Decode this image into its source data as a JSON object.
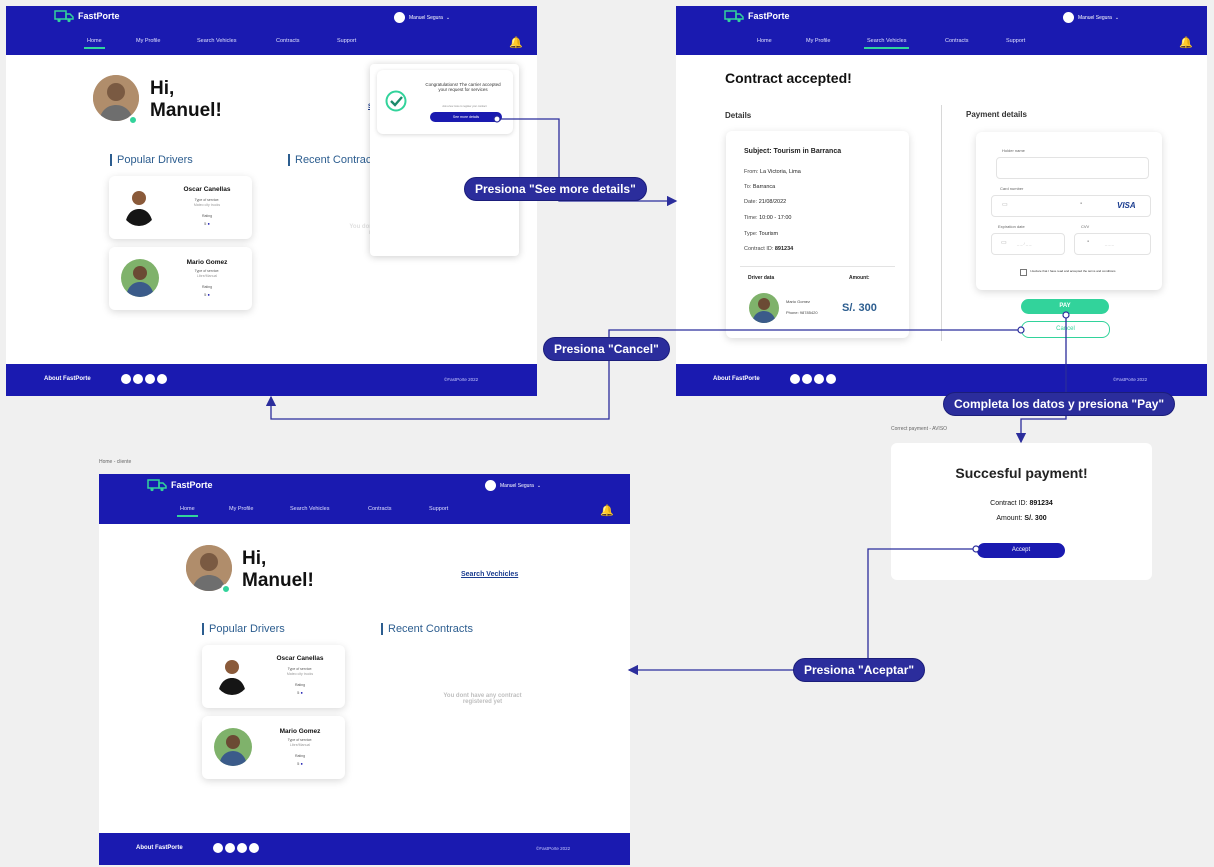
{
  "app": {
    "logo": "FastPorte",
    "user_name": "Manuel Segura",
    "nav": [
      "Home",
      "My Profile",
      "Search Vehicles",
      "Contracts",
      "Support"
    ],
    "footer_about": "About FastPorte",
    "copyright": "©FastPorte 2022"
  },
  "home": {
    "greeting_line1": "Hi,",
    "greeting_line2": "Manuel!",
    "search_link": "Search Vechicles",
    "popular_title": "Popular Drivers",
    "recent_title": "Recent Contracts",
    "empty_text": "You dont have any contract registered yet",
    "drivers": [
      {
        "name": "Oscar Canellas",
        "type_label": "Type of service:",
        "type_value": "Mateo city trucks",
        "rating_label": "Rating",
        "rating_value": "5"
      },
      {
        "name": "Mario Gomez",
        "type_label": "Type of service:",
        "type_value": "Libre/Manual",
        "rating_label": "Rating",
        "rating_value": "5"
      }
    ]
  },
  "home_bottom": {
    "breadcrumb": "Home - cliente"
  },
  "notification": {
    "message": "Congratulations! The carrier accepted your request for services",
    "subtext": "Ask a few more to register your contract",
    "button": "See more details"
  },
  "contract": {
    "title": "Contract accepted!",
    "details_title": "Details",
    "subject": "Subject: Tourism in Barranca",
    "from_label": "From:",
    "from_value": "La Victoria, Lima",
    "to_label": "To:",
    "to_value": "Barranca",
    "date_label": "Date:",
    "date_value": "21/08/2022",
    "time_label": "Time:",
    "time_value": "10:00 - 17:00",
    "type_label": "Type:",
    "type_value": "Tourism",
    "id_label": "Contract ID:",
    "id_value": "891234",
    "driver_data_label": "Driver data",
    "amount_label": "Amount:",
    "driver_name": "Mario Gomez",
    "driver_phone": "Phone: 98785420",
    "amount_value": "S/. 300",
    "payment_title": "Payment details",
    "holder_label": "Holder name",
    "card_label": "Card number",
    "card_brand": "VISA",
    "expiry_label": "Expiration date",
    "cvv_label": "CVV",
    "terms_text": "I declare that I have read and accepted the terms and conditions",
    "pay_button": "PAY",
    "cancel_button": "Cancel"
  },
  "payment": {
    "caption": "Correct payment - AVISO",
    "title": "Succesful payment!",
    "id_label": "Contract ID:",
    "id_value": "891234",
    "amount_label": "Amount:",
    "amount_value": "S/. 300",
    "accept_button": "Accept"
  },
  "callouts": {
    "see_more": "Presiona \"See more details\"",
    "cancel": "Presiona \"Cancel\"",
    "pay": "Completa los datos y presiona \"Pay\"",
    "aceptar": "Presiona \"Aceptar\""
  },
  "colors": {
    "brand_blue": "#1a1ab0",
    "accent_green": "#32d39b",
    "callout_bg": "#2b2d9c"
  }
}
